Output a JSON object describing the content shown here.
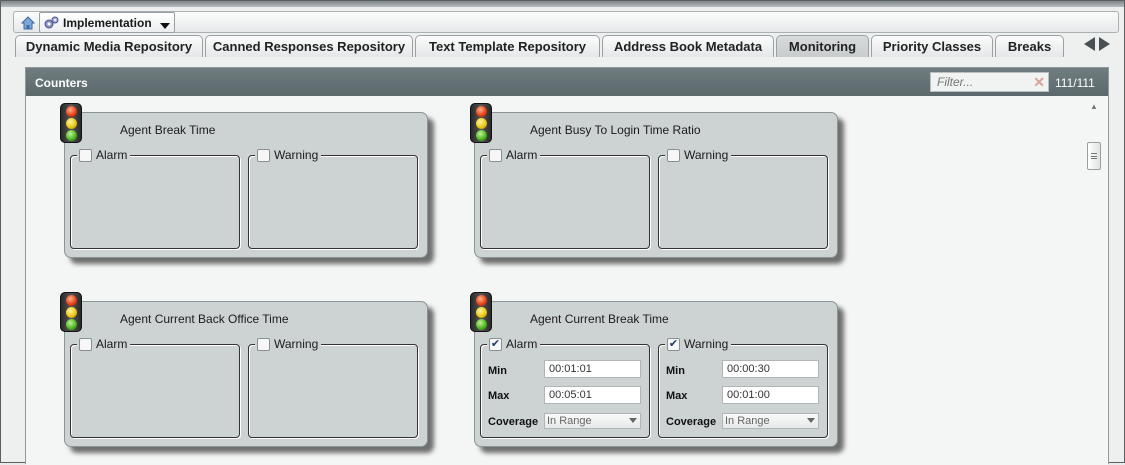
{
  "breadcrumb": {
    "current": "Implementation"
  },
  "tabs": [
    {
      "label": "Dynamic Media Repository",
      "active": false
    },
    {
      "label": "Canned Responses Repository",
      "active": false
    },
    {
      "label": "Text Template Repository",
      "active": false
    },
    {
      "label": "Address Book Metadata",
      "active": false
    },
    {
      "label": "Monitoring",
      "active": true
    },
    {
      "label": "Priority Classes",
      "active": false
    },
    {
      "label": "Breaks",
      "active": false
    }
  ],
  "panel": {
    "title": "Counters",
    "filter_placeholder": "Filter...",
    "count": "111/111"
  },
  "labels": {
    "alarm": "Alarm",
    "warning": "Warning",
    "min": "Min",
    "max": "Max",
    "coverage": "Coverage"
  },
  "counters": [
    {
      "title": "Agent Break Time",
      "alarm_checked": false,
      "warning_checked": false
    },
    {
      "title": "Agent Busy To Login Time Ratio",
      "alarm_checked": false,
      "warning_checked": false
    },
    {
      "title": "Agent Current Back Office Time",
      "alarm_checked": false,
      "warning_checked": false
    },
    {
      "title": "Agent Current Break Time",
      "alarm_checked": true,
      "warning_checked": true,
      "alarm": {
        "min": "00:01:01",
        "max": "00:05:01",
        "coverage": "In Range"
      },
      "warning": {
        "min": "00:00:30",
        "max": "00:01:00",
        "coverage": "In Range"
      }
    }
  ],
  "colors": {
    "header_bg": "#637174",
    "card_bg": "#cdd2d3",
    "lamp_red": "#e23a12",
    "lamp_yellow": "#e9c20c",
    "lamp_green": "#46b21a"
  },
  "icons": [
    "home-icon",
    "gear-icon",
    "chevron-down-icon",
    "arrow-left-icon",
    "arrow-right-icon",
    "close-icon",
    "traffic-light-icon",
    "scroll-up-icon"
  ]
}
